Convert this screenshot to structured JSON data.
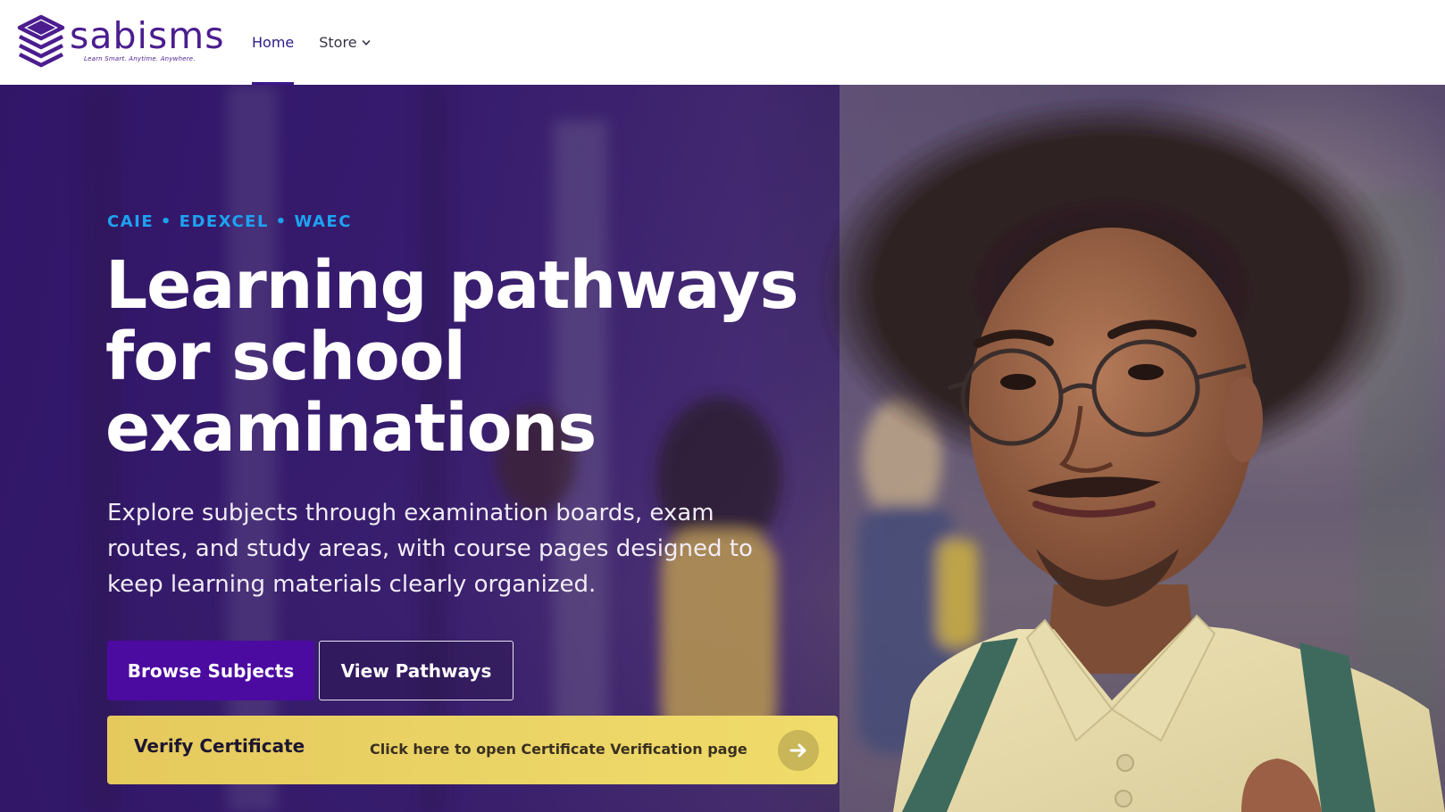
{
  "brand": {
    "name": "sabisms",
    "tagline": "Learn Smart. Anytime. Anywhere.",
    "color": "#4b1d8f"
  },
  "nav": {
    "items": [
      {
        "label": "Home",
        "active": true
      },
      {
        "label": "Store",
        "active": false,
        "has_dropdown": true
      }
    ]
  },
  "hero": {
    "eyebrow": "CAIE • EDEXCEL • WAEC",
    "headline": "Learning pathways for school examinations",
    "lede": "Explore subjects through examination boards, exam routes, and study areas, with course pages designed to keep learning materials clearly organized.",
    "primary_button": "Browse Subjects",
    "secondary_button": "View Pathways",
    "verify": {
      "title": "Verify Certificate",
      "subtitle": "Click here to open Certificate Verification page"
    }
  },
  "colors": {
    "accent": "#1ea2f0",
    "primary_button": "#4b0aa0",
    "verify_banner": "#ebd466",
    "overlay": "#331769"
  },
  "icons": [
    "logo-mark-icon",
    "chevron-down-icon",
    "arrow-right-icon"
  ]
}
